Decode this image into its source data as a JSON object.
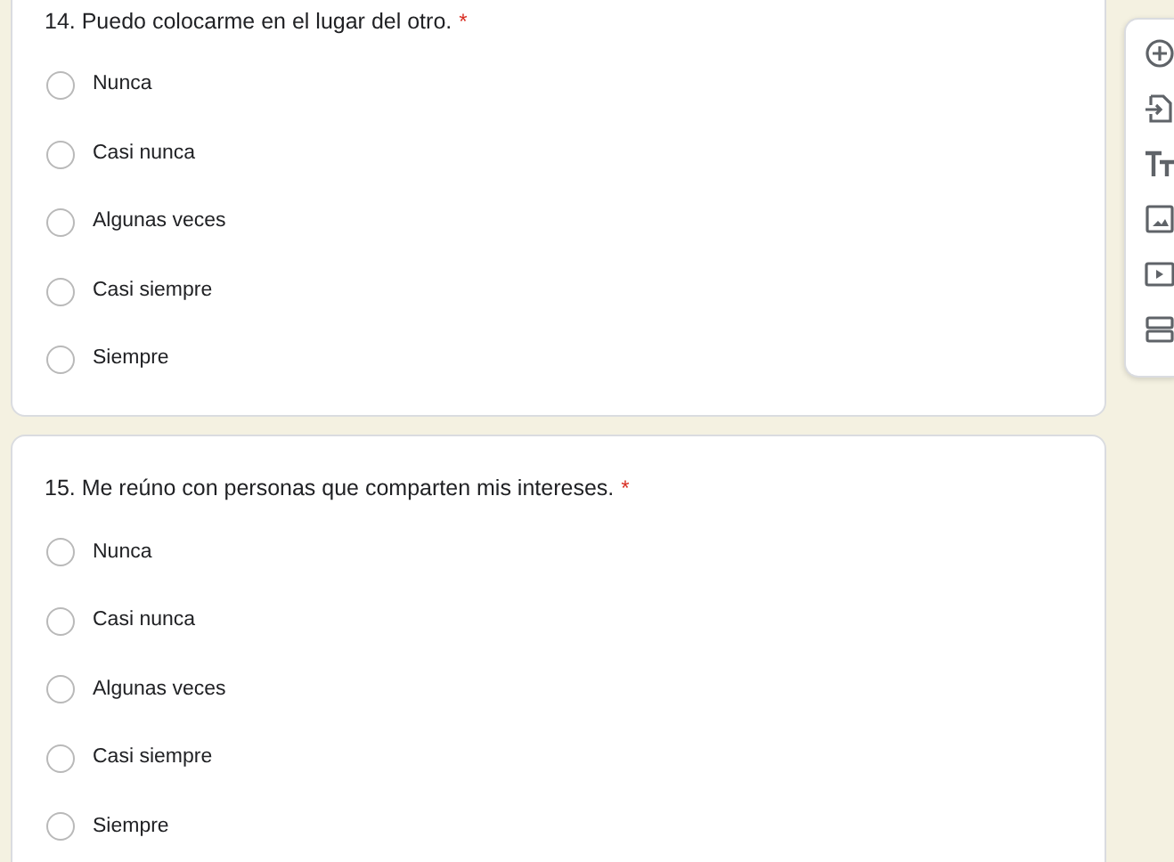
{
  "questions": [
    {
      "title": "14. Puedo colocarme en el lugar del otro.",
      "required_mark": "*",
      "options": [
        {
          "label": "Nunca",
          "selected": false
        },
        {
          "label": "Casi nunca",
          "selected": false
        },
        {
          "label": "Algunas veces",
          "selected": false
        },
        {
          "label": "Casi siempre",
          "selected": false
        },
        {
          "label": "Siempre",
          "selected": false
        }
      ]
    },
    {
      "title": "15. Me reúno con personas que comparten mis intereses.",
      "required_mark": "*",
      "options": [
        {
          "label": "Nunca",
          "selected": false
        },
        {
          "label": "Casi nunca",
          "selected": false
        },
        {
          "label": "Algunas veces",
          "selected": false
        },
        {
          "label": "Casi siempre",
          "selected": false
        },
        {
          "label": "Siempre",
          "selected": false
        }
      ]
    }
  ],
  "toolbar": [
    {
      "kind": "add"
    },
    {
      "kind": "import"
    },
    {
      "kind": "text"
    },
    {
      "kind": "image"
    },
    {
      "kind": "video"
    },
    {
      "kind": "section"
    }
  ]
}
